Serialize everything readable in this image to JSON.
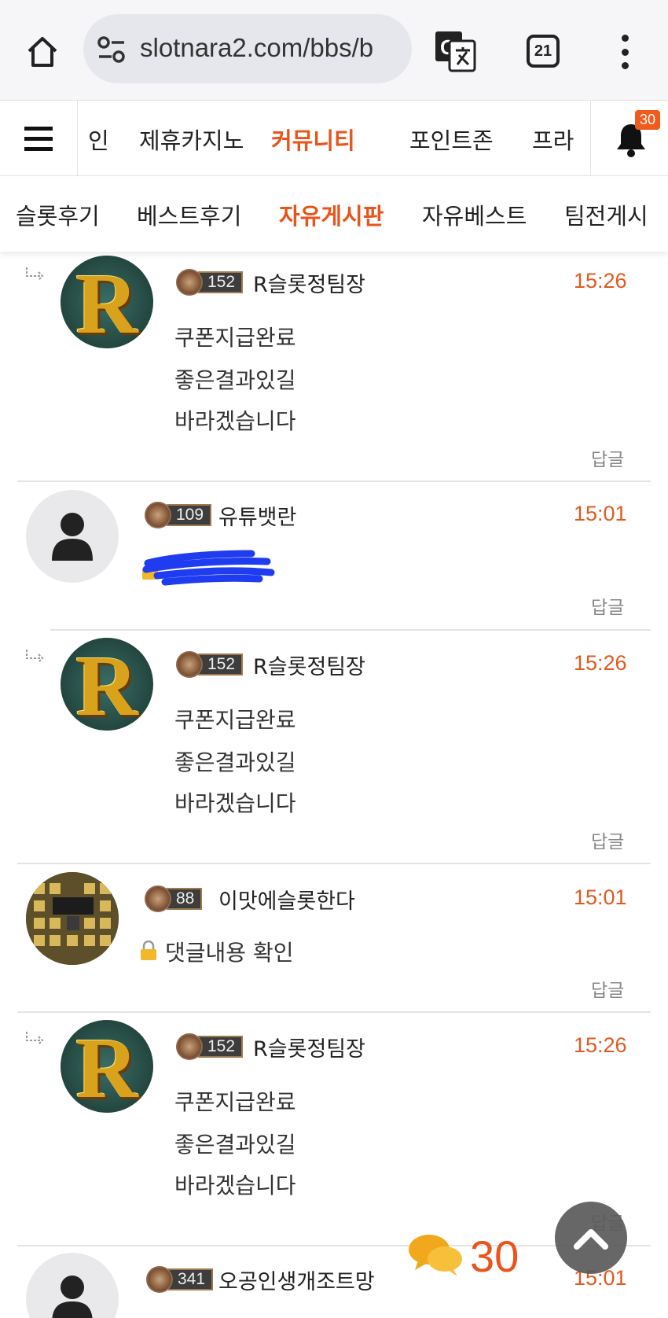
{
  "browser": {
    "url": "slotnara2.com/bbs/b",
    "tab_count": "21"
  },
  "site_nav": {
    "tabs": [
      {
        "label": "인"
      },
      {
        "label": "제휴카지노"
      },
      {
        "label": "커뮤니티"
      },
      {
        "label": "포인트존"
      },
      {
        "label": "프라"
      }
    ],
    "active_tab": "커뮤니티",
    "notification_count": "30"
  },
  "sub_nav": {
    "tabs": [
      {
        "label": "슬롯후기"
      },
      {
        "label": "베스트후기"
      },
      {
        "label": "자유게시판"
      },
      {
        "label": "자유베스트"
      },
      {
        "label": "팀전게시"
      }
    ],
    "active_tab": "자유게시판"
  },
  "comments": [
    {
      "level": "152",
      "username": "R슬롯정팀장",
      "time": "15:26",
      "lines": [
        "쿠폰지급완료",
        "좋은결과있길",
        "바라겠습니다"
      ],
      "reply_label": "답글"
    },
    {
      "level": "109",
      "username": "유튜뱃란",
      "time": "15:01",
      "lines": [],
      "reply_label": "답글"
    },
    {
      "level": "152",
      "username": "R슬롯정팀장",
      "time": "15:26",
      "lines": [
        "쿠폰지급완료",
        "좋은결과있길",
        "바라겠습니다"
      ],
      "reply_label": "답글"
    },
    {
      "level": "88",
      "username": "이맛에슬롯한다",
      "time": "15:01",
      "lines": [
        "댓글내용 확인"
      ],
      "reply_label": "답글"
    },
    {
      "level": "152",
      "username": "R슬롯정팀장",
      "time": "15:26",
      "lines": [
        "쿠폰지급완료",
        "좋은결과있길",
        "바라겠습니다"
      ],
      "reply_label": "답글"
    },
    {
      "level": "341",
      "username": "오공인생개조트망",
      "time": "15:01",
      "lines": [],
      "reply_label": ""
    }
  ],
  "floating": {
    "comment_count": "30"
  },
  "avatar_letter": "R",
  "colors": {
    "accent": "#e8541c",
    "time": "#e05a1f",
    "scribble": "#1f3cf0"
  },
  "icons": [
    "home-icon",
    "site-settings-icon",
    "translate-icon",
    "tab-switcher-icon",
    "more-menu-icon",
    "hamburger-icon",
    "bell-icon",
    "reply-arrow-icon",
    "lock-icon",
    "comment-bubbles-icon",
    "chevron-up-icon",
    "user-silhouette-icon"
  ]
}
